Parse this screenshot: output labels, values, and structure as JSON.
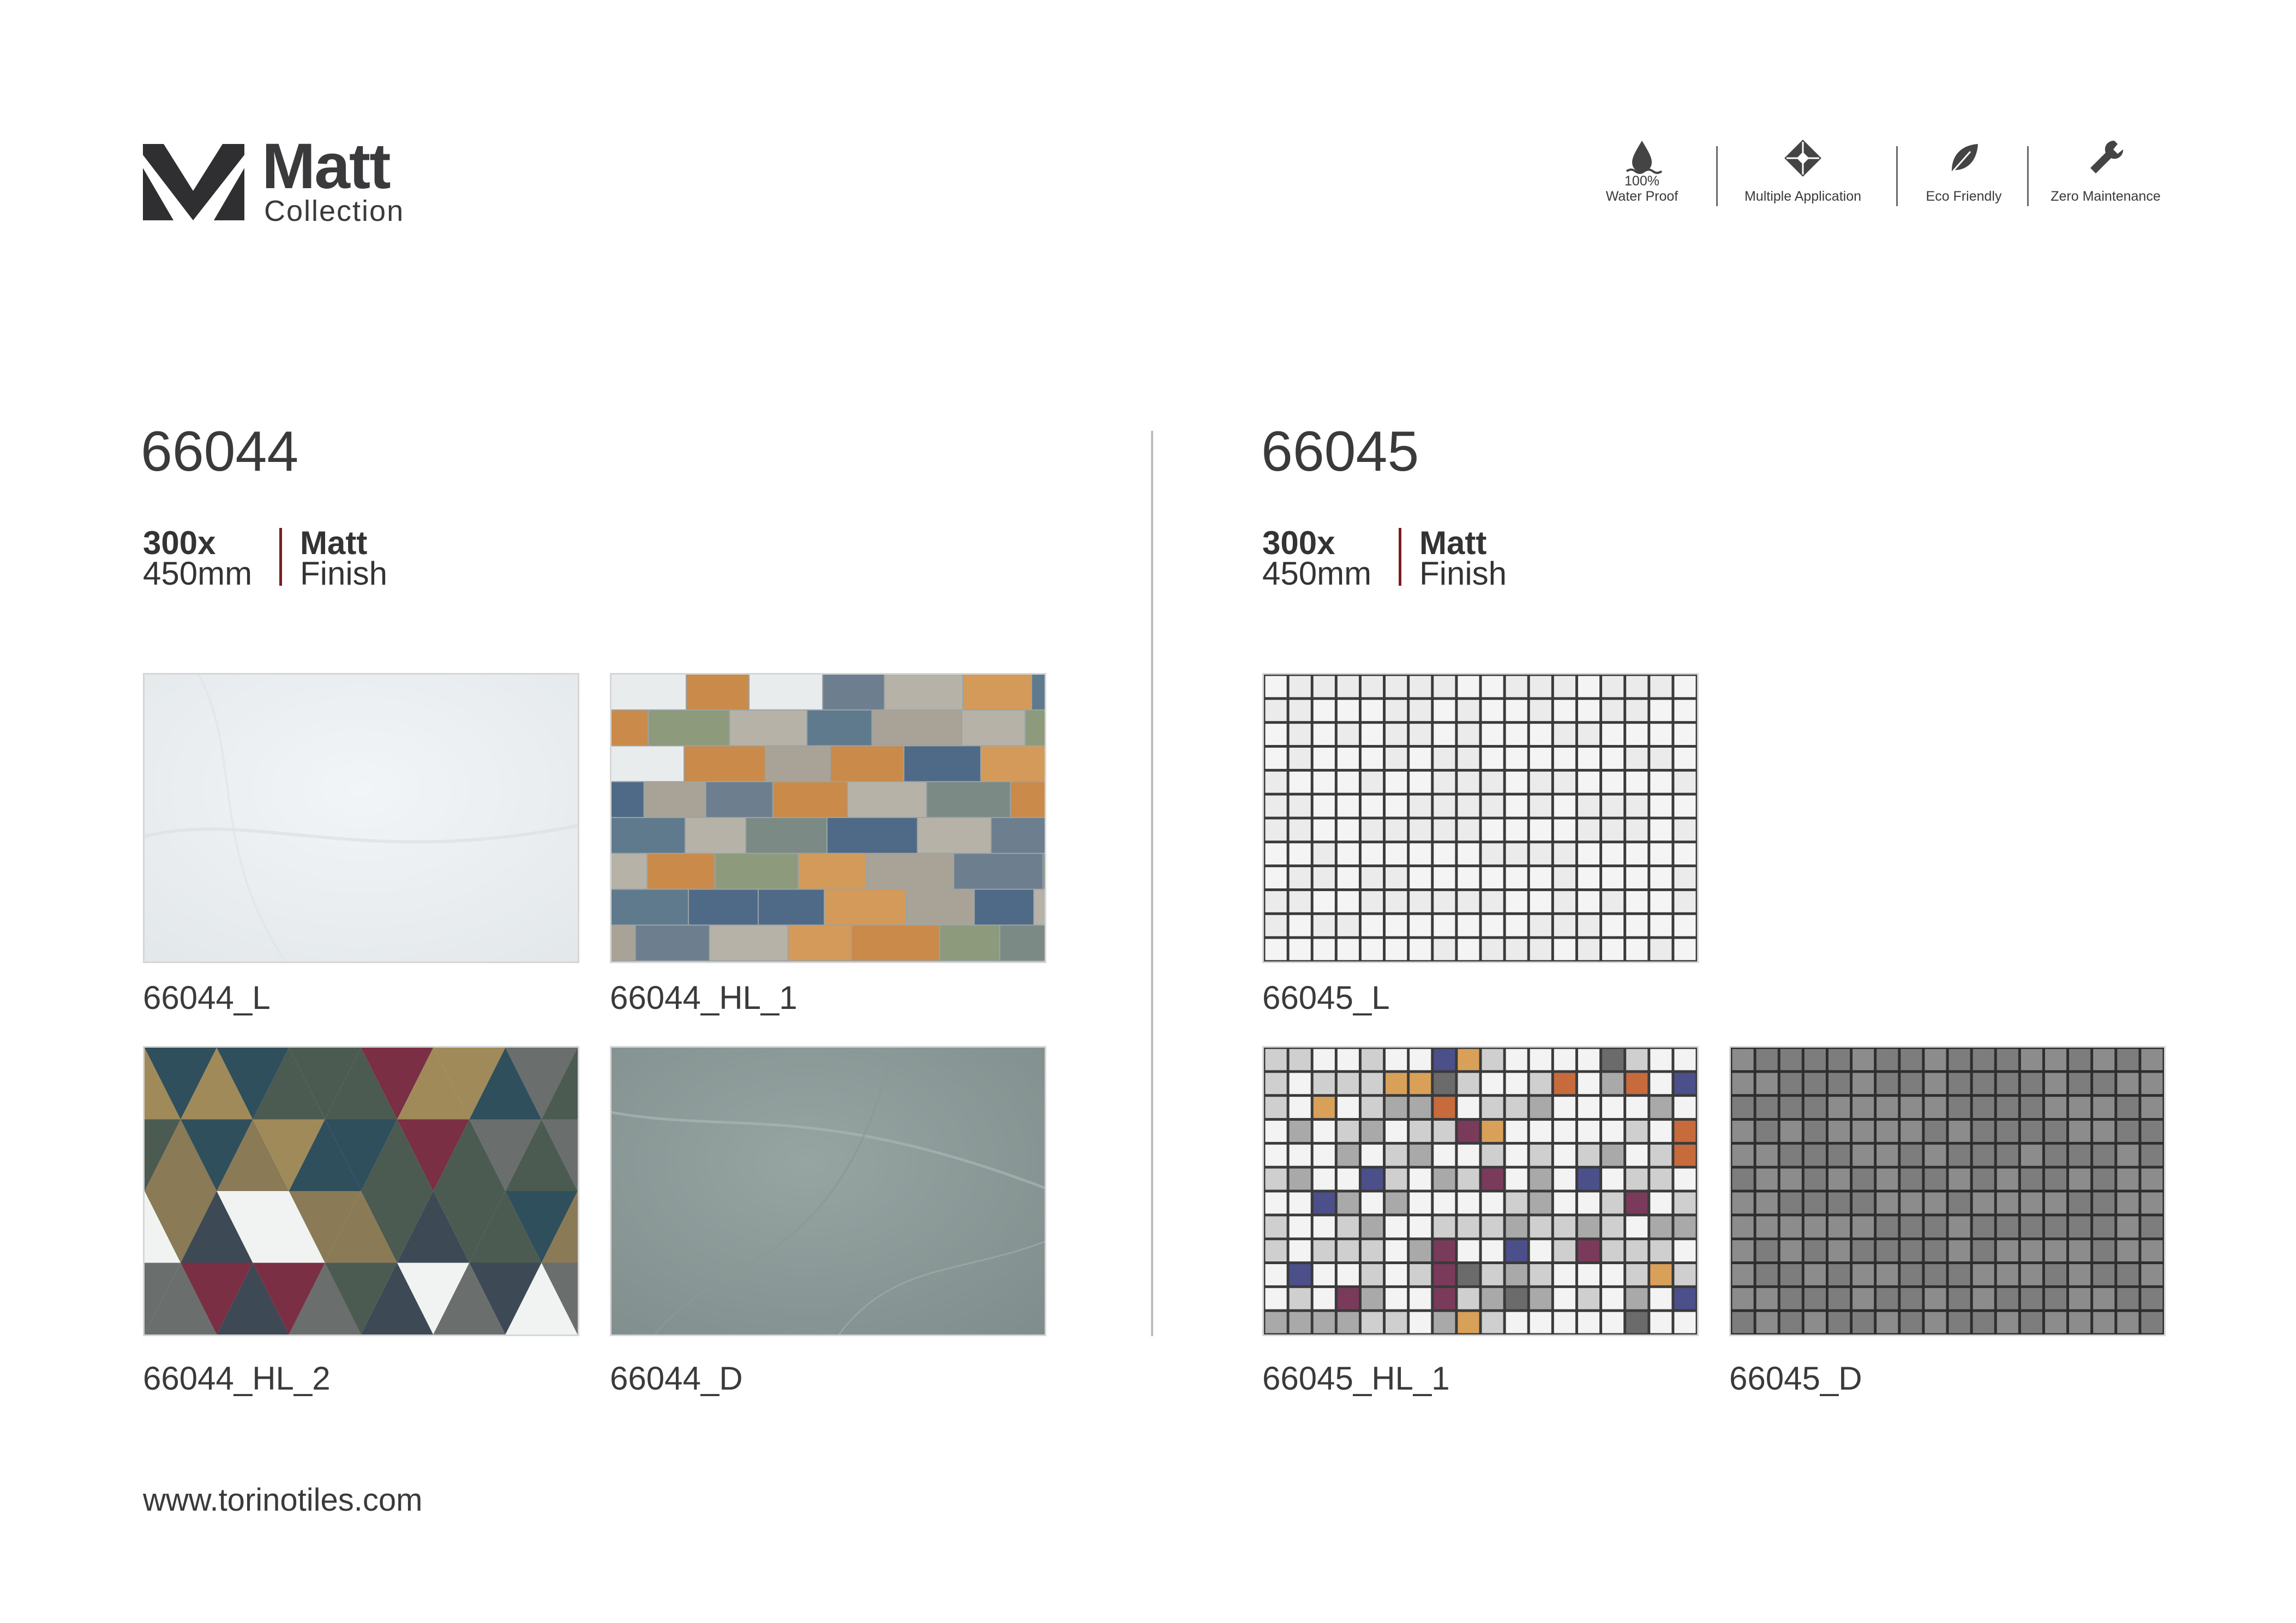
{
  "brand": {
    "title": "Matt",
    "subtitle": "Collection"
  },
  "features": [
    {
      "icon": "water-drop-icon",
      "line1": "100%",
      "line2": "Water Proof"
    },
    {
      "icon": "multiple-application-icon",
      "line1": "",
      "line2": "Multiple Application"
    },
    {
      "icon": "leaf-icon",
      "line1": "",
      "line2": "Eco Friendly"
    },
    {
      "icon": "wrench-icon",
      "line1": "",
      "line2": "Zero Maintenance"
    }
  ],
  "left": {
    "title": "66044",
    "size_line1": "300x",
    "size_line2": "450mm",
    "finish_line1": "Matt",
    "finish_line2": "Finish",
    "tiles": [
      {
        "label": "66044_L"
      },
      {
        "label": "66044_HL_1"
      },
      {
        "label": "66044_HL_2"
      },
      {
        "label": "66044_D"
      }
    ]
  },
  "right": {
    "title": "66045",
    "size_line1": "300x",
    "size_line2": "450mm",
    "finish_line1": "Matt",
    "finish_line2": "Finish",
    "tiles": [
      {
        "label": "66045_L"
      },
      {
        "label": "66045_HL_1"
      },
      {
        "label": "66045_D"
      }
    ]
  },
  "footer": {
    "website": "www.torinotiles.com"
  },
  "colors": {
    "text": "#3a3a3c",
    "accent_bar": "#7a1f1f",
    "divider": "#bdbdbd"
  }
}
